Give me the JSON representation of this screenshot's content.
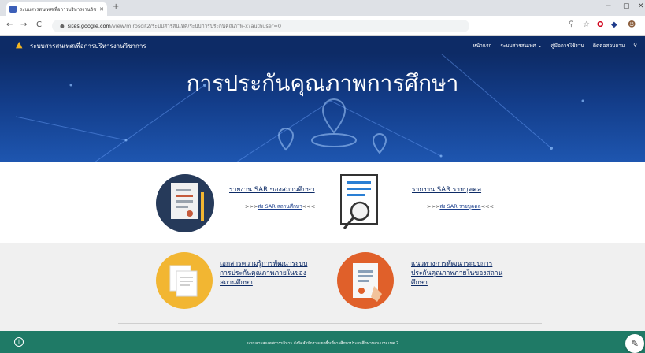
{
  "browser": {
    "tab_title": "ระบบสารสนเทศเพื่อการบริหารงานวิชา",
    "tab_close": "✕",
    "new_tab": "+",
    "url_host": "sites.google.com",
    "url_path": "/view/mirosoit2/ระบบสารสนเทศ/ระบบการประกนคณภาพ-x?authuser=0",
    "nav_back": "←",
    "nav_forward": "→",
    "nav_reload": "C",
    "win_min": "−",
    "win_max": "▢",
    "win_close": "✕"
  },
  "site": {
    "title": "ระบบสารสนเทศเพื่อการบริหารงานวิชาการ",
    "nav": [
      "หน้าแรก",
      "ระบบสารสนเทศ ⌄",
      "คู่มือการใช้งาน",
      "ติดต่อสอบถาม"
    ],
    "hero_title": "การประกันคุณภาพการศึกษา"
  },
  "sections": {
    "sar_school_title": "รายงาน SAR ของสถานศึกษา",
    "sar_school_link": "ส่ง SAR สถานศึกษา",
    "sar_person_title": "รายงาน SAR รายบุคคล",
    "sar_person_link": "ส่ง SAR รายบุคคล",
    "doc_knowledge_title": "เอกสารความรู้การพัฒนาระบบการประกันคุณภาพภายในของสถานศึกษา",
    "guideline_title": "แนวทางการพัฒนาระบบการประกันคุณภาพภายในของสถานศึกษา",
    "link_prefix": ">>>",
    "link_suffix": "<<<"
  },
  "footer": {
    "text": "ระบบสารสนเทศการบริหาร สังกัดสำนักงานเขตพื้นที่การศึกษาประถมศึกษาขอนแก่น เขต 2",
    "info": "i",
    "edit": "✎"
  },
  "colors": {
    "nav_bg": "#0d2b66",
    "footer_bg": "#1f7a66",
    "link": "#0d2b66"
  }
}
